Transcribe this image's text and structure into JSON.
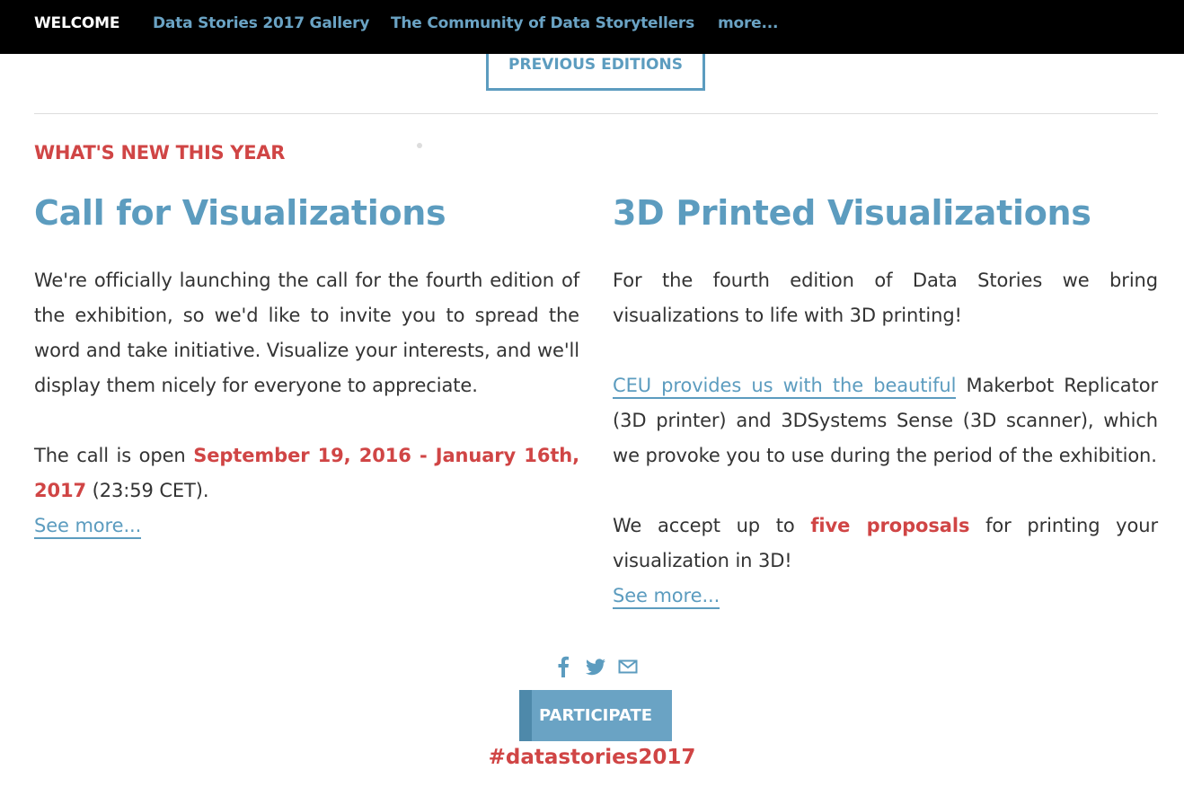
{
  "nav": {
    "items": [
      {
        "label": "WELCOME"
      },
      {
        "label": "Data Stories 2017 Gallery"
      },
      {
        "label": "The Community of Data Storytellers"
      },
      {
        "label": "more..."
      }
    ]
  },
  "previous_editions_label": "PREVIOUS EDITIONS",
  "section_label": "WHAT'S NEW THIS YEAR",
  "left": {
    "title": "Call for Visualizations",
    "para1": "We're officially launching the call for the fourth edition of the exhibition, so we'd like to invite you to spread the word and take initiative. Visualize your interests, and we'll display them nicely for everyone to appreciate.",
    "para2_prefix": "The call is open ",
    "para2_dates": "September 19, 2016 - January 16th, 2017",
    "para2_suffix": " (23:59 CET).",
    "see_more": "See more..."
  },
  "right": {
    "title": "3D Printed Visualizations",
    "para1": "For the fourth edition of Data Stories we bring visualizations to life with 3D printing!",
    "para2_link": "CEU provides us with the beautiful",
    "para2_rest": " Makerbot Replicator (3D printer) and 3DSystems Sense (3D scanner), which we provoke you to use during the period of the exhibition.",
    "para3_prefix": "We accept up to ",
    "para3_highlight": "five proposals",
    "para3_suffix": " for printing your visualization in 3D!",
    "see_more": "See more..."
  },
  "social": {
    "icons": [
      "facebook-icon",
      "twitter-icon",
      "mail-icon"
    ]
  },
  "participate_label": "PARTICIPATE",
  "hashtag": "#datastories2017",
  "colors": {
    "accent_blue": "#5c9cbf",
    "accent_red": "#d04545",
    "nav_background": "#000000"
  }
}
